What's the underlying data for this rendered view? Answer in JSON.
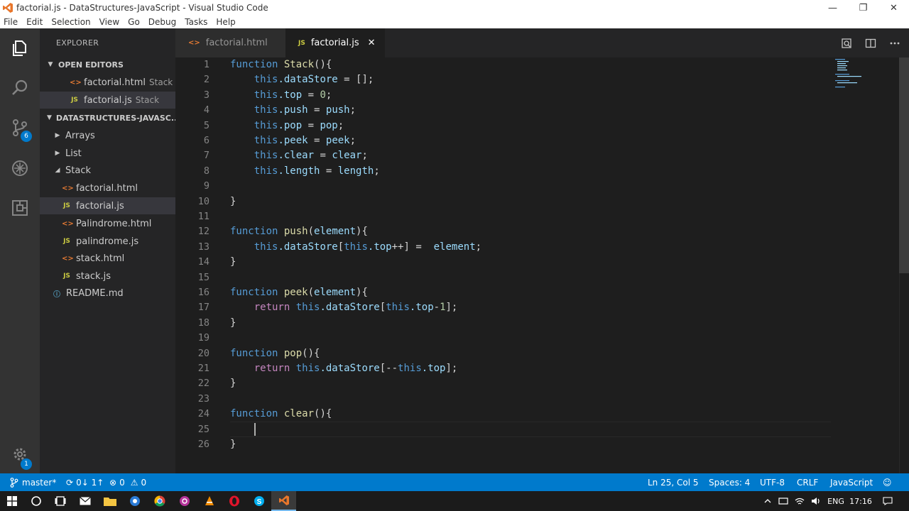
{
  "window": {
    "title": "factorial.js - DataStructures-JavaScript - Visual Studio Code",
    "minimize": "—",
    "restore": "❐",
    "close": "✕"
  },
  "menu": [
    "File",
    "Edit",
    "Selection",
    "View",
    "Go",
    "Debug",
    "Tasks",
    "Help"
  ],
  "activity": {
    "scm_badge": "6",
    "settings_badge": "1"
  },
  "sidebar": {
    "header": "EXPLORER",
    "open_editors_label": "OPEN EDITORS",
    "open_editors": [
      {
        "name": "factorial.html",
        "hint": "Stack",
        "type": "html"
      },
      {
        "name": "factorial.js",
        "hint": "Stack",
        "type": "js"
      }
    ],
    "workspace_label": "DATASTRUCTURES-JAVASC...",
    "tree": [
      {
        "name": "Arrays",
        "kind": "folder",
        "expanded": false
      },
      {
        "name": "List",
        "kind": "folder",
        "expanded": false
      },
      {
        "name": "Stack",
        "kind": "folder",
        "expanded": true
      },
      {
        "name": "factorial.html",
        "kind": "html"
      },
      {
        "name": "factorial.js",
        "kind": "js"
      },
      {
        "name": "Palindrome.html",
        "kind": "html"
      },
      {
        "name": "palindrome.js",
        "kind": "js"
      },
      {
        "name": "stack.html",
        "kind": "html"
      },
      {
        "name": "stack.js",
        "kind": "js"
      },
      {
        "name": "README.md",
        "kind": "md"
      }
    ]
  },
  "tabs": [
    {
      "label": "factorial.html",
      "icon": "<>"
    },
    {
      "label": "factorial.js",
      "icon": "JS",
      "close": "✕"
    }
  ],
  "editor": {
    "lines": [
      {
        "n": "1"
      },
      {
        "n": "2"
      },
      {
        "n": "3"
      },
      {
        "n": "4"
      },
      {
        "n": "5"
      },
      {
        "n": "6"
      },
      {
        "n": "7"
      },
      {
        "n": "8"
      },
      {
        "n": "9"
      },
      {
        "n": "10"
      },
      {
        "n": "11"
      },
      {
        "n": "12"
      },
      {
        "n": "13"
      },
      {
        "n": "14"
      },
      {
        "n": "15"
      },
      {
        "n": "16"
      },
      {
        "n": "17"
      },
      {
        "n": "18"
      },
      {
        "n": "19"
      },
      {
        "n": "20"
      },
      {
        "n": "21"
      },
      {
        "n": "22"
      },
      {
        "n": "23"
      },
      {
        "n": "24"
      },
      {
        "n": "25"
      },
      {
        "n": "26"
      }
    ],
    "code": {
      "l1_kw": "function",
      "l1_fn": "Stack",
      "l1_rest": "(){",
      "l2_this": "this",
      "l2_prop": ".dataStore",
      "l2_rest": " = [];",
      "l3_this": "this",
      "l3_prop": ".top",
      "l3_eq": " = ",
      "l3_num": "0",
      "l3_end": ";",
      "l4_this": "this",
      "l4_prop": ".push",
      "l4_eq": " = ",
      "l4_var": "push",
      "l4_end": ";",
      "l5_this": "this",
      "l5_prop": ".pop",
      "l5_eq": " = ",
      "l5_var": "pop",
      "l5_end": ";",
      "l6_this": "this",
      "l6_prop": ".peek",
      "l6_eq": " = ",
      "l6_var": "peek",
      "l6_end": ";",
      "l7_this": "this",
      "l7_prop": ".clear",
      "l7_eq": " = ",
      "l7_var": "clear",
      "l7_end": ";",
      "l8_this": "this",
      "l8_prop": ".length",
      "l8_eq": " = ",
      "l8_var": "length",
      "l8_end": ";",
      "l10": "}",
      "l12_kw": "function",
      "l12_fn": "push",
      "l12_p": "(",
      "l12_arg": "element",
      "l12_end": "){",
      "l13_this": "this",
      "l13_prop": ".dataStore",
      "l13_b": "[",
      "l13_this2": "this",
      "l13_prop2": ".top",
      "l13_op": "++] =  ",
      "l13_var": "element",
      "l13_end": ";",
      "l14": "}",
      "l16_kw": "function",
      "l16_fn": "peek",
      "l16_p": "(",
      "l16_arg": "element",
      "l16_end": "){",
      "l17_ret": "return",
      "l17_this": "this",
      "l17_prop": ".dataStore",
      "l17_b": "[",
      "l17_this2": "this",
      "l17_prop2": ".top",
      "l17_op": "-",
      "l17_num": "1",
      "l17_end": "];",
      "l18": "}",
      "l20_kw": "function",
      "l20_fn": "pop",
      "l20_end": "(){",
      "l21_ret": "return",
      "l21_this": "this",
      "l21_prop": ".dataStore",
      "l21_b": "[--",
      "l21_this2": "this",
      "l21_prop2": ".top",
      "l21_end": "];",
      "l22": "}",
      "l24_kw": "function",
      "l24_fn": "clear",
      "l24_end": "(){",
      "l26": "}"
    }
  },
  "statusbar": {
    "branch": "master*",
    "sync": "0↓ 1↑",
    "errors": "0",
    "warnings": "0",
    "position": "Ln 25, Col 5",
    "spaces": "Spaces: 4",
    "encoding": "UTF-8",
    "eol": "CRLF",
    "language": "JavaScript"
  },
  "taskbar": {
    "lang": "ENG",
    "time": "17:16"
  },
  "colors": {
    "accent": "#007acc",
    "keyword": "#569cd6",
    "function": "#dcdcaa",
    "number": "#b5cea8",
    "variable": "#9cdcfe"
  }
}
